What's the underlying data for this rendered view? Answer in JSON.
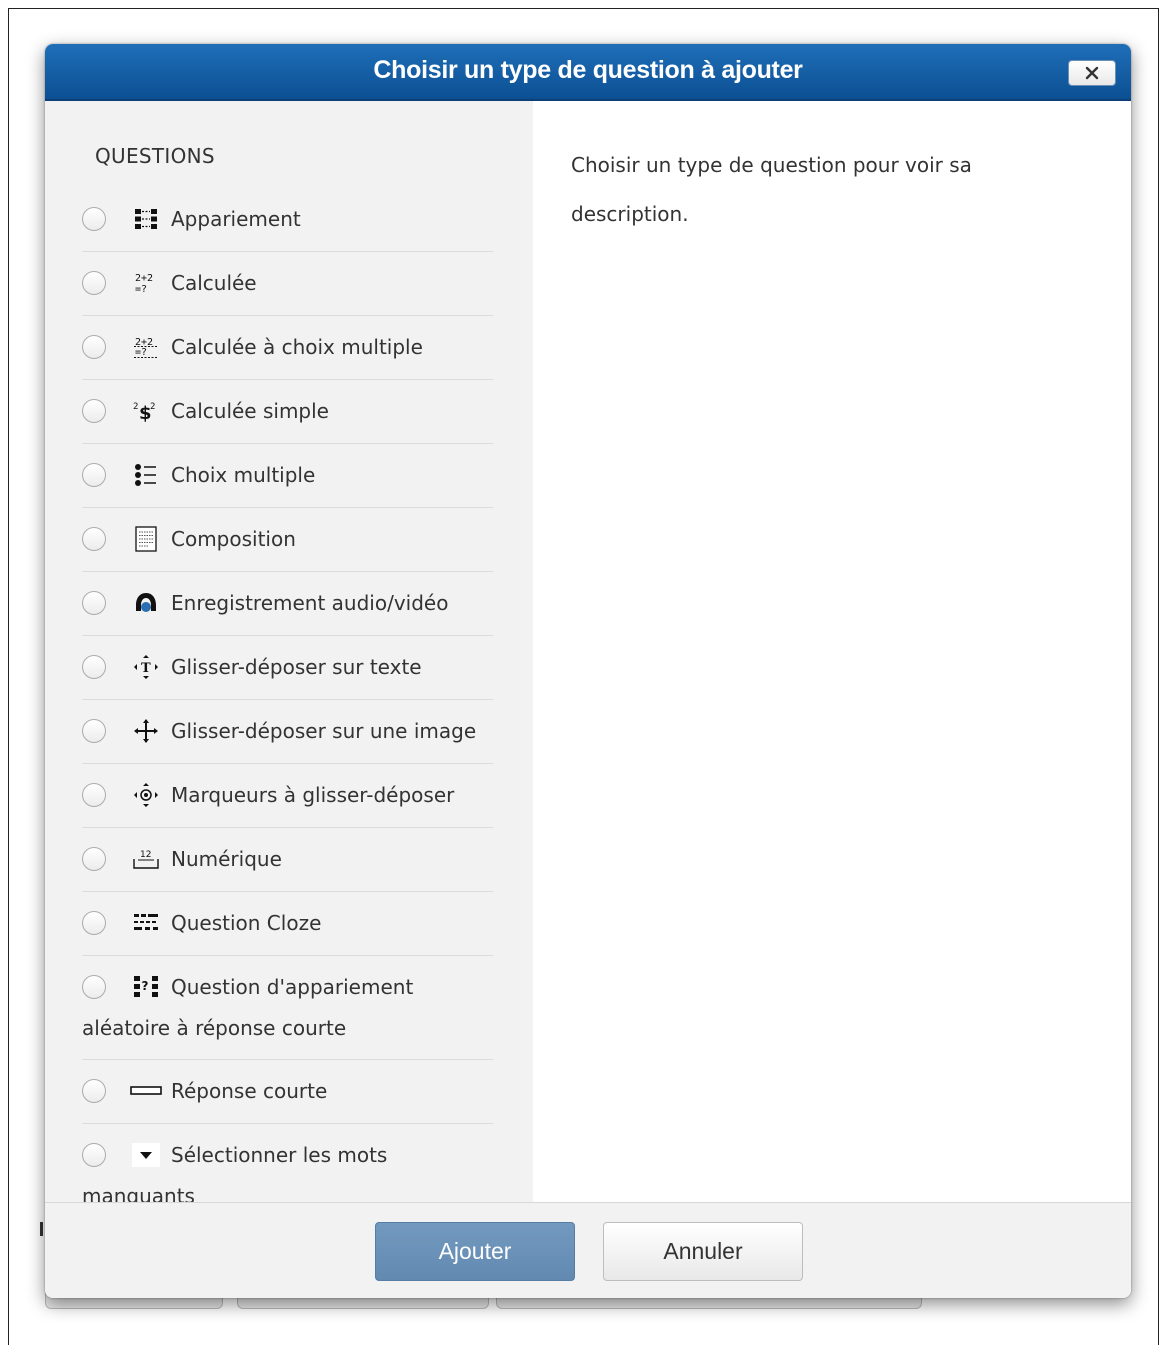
{
  "dialog": {
    "title": "Choisir un type de question à ajouter",
    "close_icon": "close-x-icon"
  },
  "questions": {
    "section_title": "QUESTIONS",
    "items": [
      {
        "label": "Appariement",
        "icon": "matching-icon"
      },
      {
        "label": "Calculée",
        "icon": "calculated-icon"
      },
      {
        "label": "Calculée à choix multiple",
        "icon": "calculated-multichoice-icon"
      },
      {
        "label": "Calculée simple",
        "icon": "calculated-simple-icon"
      },
      {
        "label": "Choix multiple",
        "icon": "multichoice-icon"
      },
      {
        "label": "Composition",
        "icon": "essay-icon"
      },
      {
        "label": "Enregistrement audio/vidéo",
        "icon": "audio-video-icon"
      },
      {
        "label": "Glisser-déposer sur texte",
        "icon": "drag-drop-text-icon"
      },
      {
        "label": "Glisser-déposer sur une image",
        "icon": "drag-drop-image-icon"
      },
      {
        "label": "Marqueurs à glisser-déposer",
        "icon": "drag-drop-markers-icon"
      },
      {
        "label": "Numérique",
        "icon": "numerical-icon"
      },
      {
        "label": "Question Cloze",
        "icon": "cloze-icon"
      },
      {
        "label": "Question d'appariement",
        "label_cont": "aléatoire à réponse courte",
        "icon": "random-short-answer-matching-icon"
      },
      {
        "label": "Réponse courte",
        "icon": "short-answer-icon"
      },
      {
        "label": "Sélectionner les mots",
        "label_cont": "manquants",
        "icon": "select-missing-words-icon"
      }
    ]
  },
  "description": {
    "text": "Choisir un type de question pour voir sa description."
  },
  "footer": {
    "add_label": "Ajouter",
    "cancel_label": "Annuler"
  }
}
